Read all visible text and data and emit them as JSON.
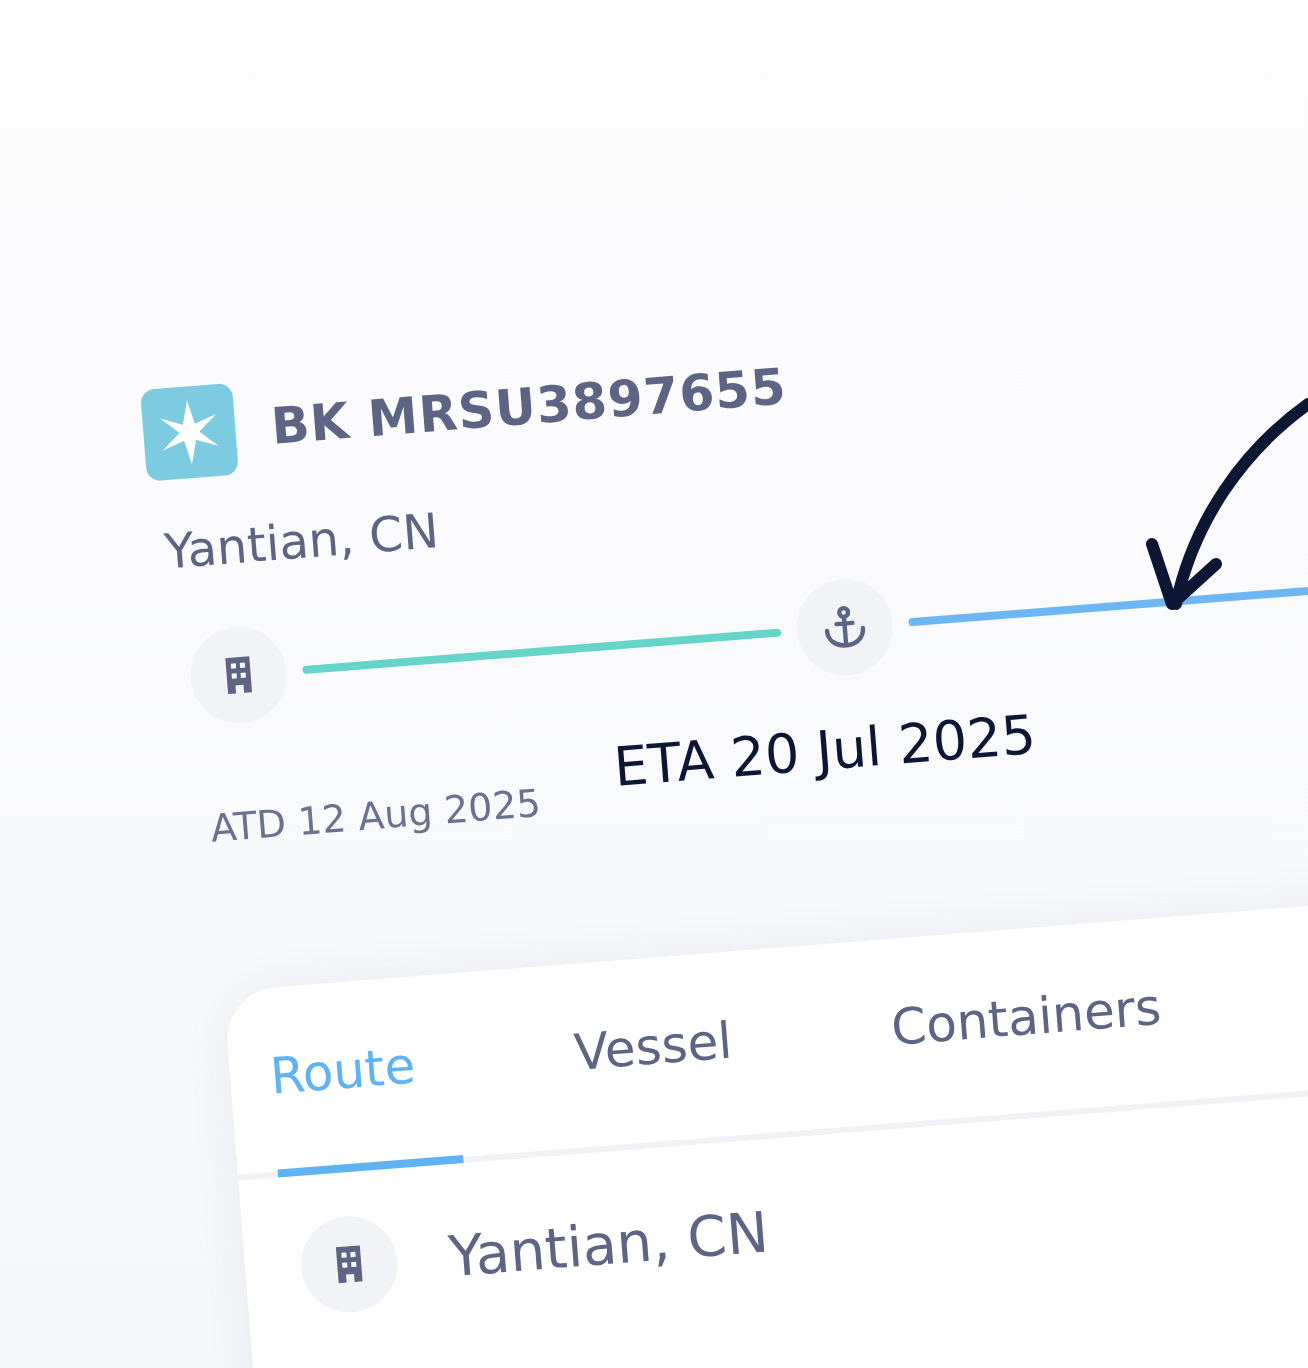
{
  "shipment": {
    "booking": "BK MRSU3897655",
    "origin": "Yantian, CN",
    "route": {
      "stops": [
        {
          "kind": "building"
        },
        {
          "kind": "anchor"
        }
      ],
      "legs": [
        {
          "color": "#66d4c8"
        },
        {
          "color": "#6cb6f4"
        }
      ]
    },
    "atd": "ATD 12 Aug 2025",
    "eta": "ETA 20 Jul 2025"
  },
  "details": {
    "tabs": [
      {
        "label": "Route",
        "selected": true
      },
      {
        "label": "Vessel",
        "selected": false
      },
      {
        "label": "Containers",
        "selected": false
      }
    ],
    "route_list": [
      {
        "kind": "building",
        "place": "Yantian, CN"
      }
    ]
  }
}
